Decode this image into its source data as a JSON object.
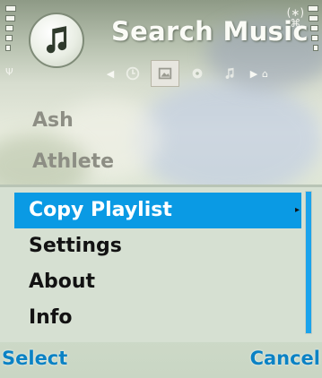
{
  "header": {
    "title": "Search Music",
    "app_icon": "music-note-icon",
    "tabs": [
      {
        "icon": "clock-icon"
      },
      {
        "icon": "photo-icon",
        "active": true
      },
      {
        "icon": "record-icon"
      },
      {
        "icon": "music-note-icon"
      }
    ]
  },
  "background_list": {
    "items": [
      {
        "label": "Ash"
      },
      {
        "label": "Athlete"
      }
    ]
  },
  "options_menu": {
    "items": [
      {
        "label": "Copy Playlist",
        "selected": true
      },
      {
        "label": "Settings"
      },
      {
        "label": "About"
      },
      {
        "label": "Info"
      }
    ]
  },
  "softkeys": {
    "left": "Select",
    "right": "Cancel"
  },
  "colors": {
    "highlight": "#0a9ae4",
    "softkey_text": "#0b82c4",
    "menu_background": "#d6e0d2"
  }
}
